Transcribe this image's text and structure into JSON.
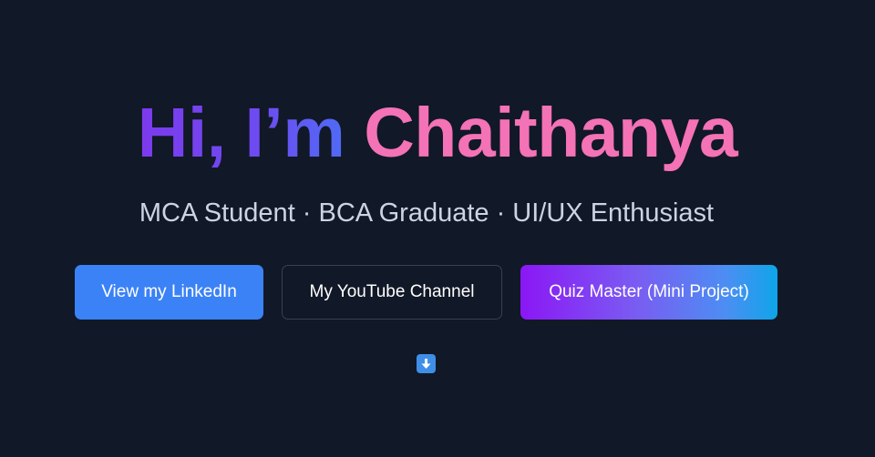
{
  "hero": {
    "greeting": "Hi, I’m",
    "name": "Chaithanya",
    "tagline": "MCA Student · BCA Graduate · UI/UX Enthusiast"
  },
  "buttons": {
    "linkedin_label": "View my LinkedIn",
    "youtube_label": "My YouTube Channel",
    "quiz_label": "Quiz Master (Mini Project)"
  },
  "scroll_cue": {
    "icon": "down-arrow-icon"
  },
  "colors": {
    "background": "#111827",
    "greeting_gradient_start": "#7c3aed",
    "greeting_gradient_end": "#4f6bf5",
    "name": "#f472b6",
    "tagline": "#cbd5e1",
    "linkedin_button": "#3b82f6",
    "quiz_gradient_start": "#8b17f5",
    "quiz_gradient_end": "#0ea5e9"
  }
}
